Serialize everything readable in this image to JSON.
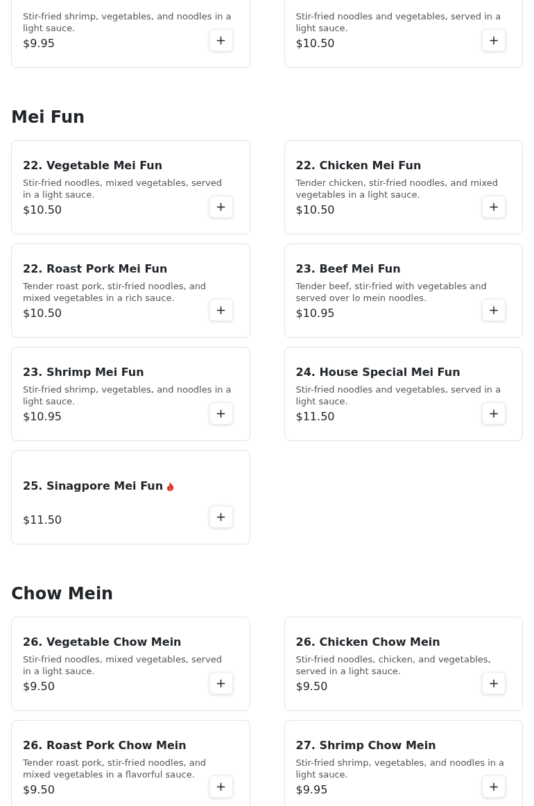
{
  "sections": [
    {
      "items": [
        {
          "description": "Stir-fried shrimp, vegetables, and noodles in a light sauce.",
          "price": "$9.95",
          "add": "+"
        },
        {
          "description": "Stir-fried noodles and vegetables, served in a light sauce.",
          "price": "$10.50",
          "add": "+"
        }
      ]
    },
    {
      "heading": "Mei Fun",
      "items": [
        {
          "title": "22. Vegetable Mei Fun",
          "description": "Stir-fried noodles, mixed vegetables, served in a light sauce.",
          "price": "$10.50",
          "add": "+"
        },
        {
          "title": "22. Chicken Mei Fun",
          "description": "Tender chicken, stir-fried noodles, and mixed vegetables in a light sauce.",
          "price": "$10.50",
          "add": "+"
        },
        {
          "title": "22. Roast Pork Mei Fun",
          "description": "Tender roast pork, stir-fried noodles, and mixed vegetables in a rich sauce.",
          "price": "$10.50",
          "add": "+"
        },
        {
          "title": "23. Beef Mei Fun",
          "description": "Tender beef, stir-fried with vegetables and served over lo mein noodles.",
          "price": "$10.95",
          "add": "+"
        },
        {
          "title": "23. Shrimp Mei Fun",
          "description": "Stir-fried shrimp, vegetables, and noodles in a light sauce.",
          "price": "$10.95",
          "add": "+"
        },
        {
          "title": "24. House Special Mei Fun",
          "description": "Stir-fried noodles and vegetables, served in a light sauce.",
          "price": "$11.50",
          "add": "+"
        },
        {
          "title": "25. Sinagpore Mei Fun",
          "spicy": true,
          "price": "$11.50",
          "add": "+"
        }
      ]
    },
    {
      "heading": "Chow Mein",
      "items": [
        {
          "title": "26. Vegetable Chow Mein",
          "description": "Stir-fried noodles, mixed vegetables, served in a light sauce.",
          "price": "$9.50",
          "add": "+"
        },
        {
          "title": "26. Chicken Chow Mein",
          "description": "Stir-fried noodles, chicken, and vegetables, served in a light sauce.",
          "price": "$9.50",
          "add": "+"
        },
        {
          "title": "26. Roast Pork Chow Mein",
          "description": "Tender roast pork, stir-fried noodles, and mixed vegetables in a flavorful sauce.",
          "price": "$9.50",
          "add": "+"
        },
        {
          "title": "27. Shrimp Chow Mein",
          "description": "Stir-fried shrimp, vegetables, and noodles in a light sauce.",
          "price": "$9.95",
          "add": "+"
        }
      ]
    }
  ]
}
